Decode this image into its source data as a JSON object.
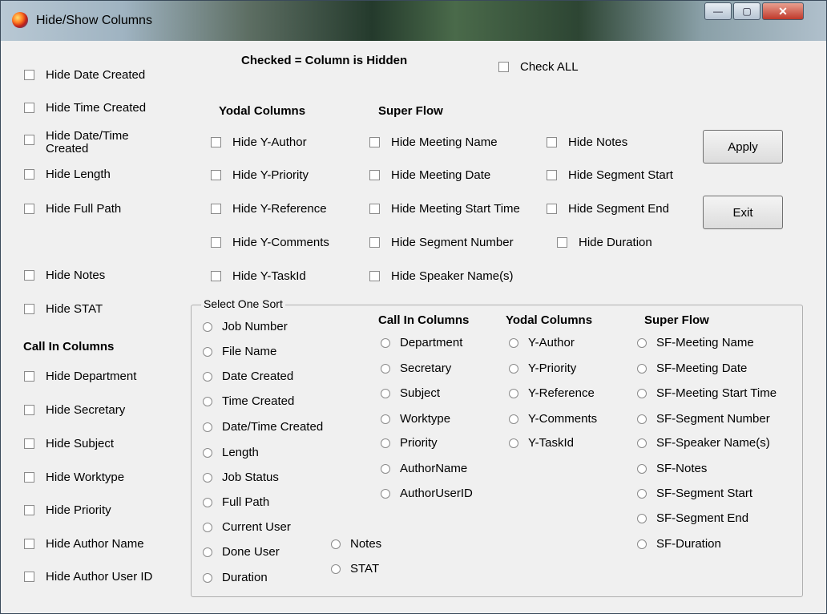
{
  "window": {
    "title": "Hide/Show Columns",
    "minimize": "—",
    "maximize": "▢",
    "close": "✕"
  },
  "header": {
    "legend": "Checked = Column is Hidden",
    "check_all": "Check ALL"
  },
  "left_checks": [
    "Hide Date Created",
    "Hide Time Created",
    "Hide Date/Time Created",
    "Hide Length",
    "Hide Full Path",
    "Hide Notes",
    "Hide STAT"
  ],
  "call_in": {
    "heading": "Call In Columns",
    "items": [
      "Hide Department",
      "Hide Secretary",
      "Hide Subject",
      "Hide Worktype",
      "Hide Priority",
      "Hide Author Name",
      "Hide Author User ID"
    ]
  },
  "yodal": {
    "heading": "Yodal Columns",
    "items": [
      "Hide Y-Author",
      "Hide Y-Priority",
      "Hide Y-Reference",
      "Hide Y-Comments",
      "Hide Y-TaskId"
    ]
  },
  "super_flow": {
    "heading": "Super Flow",
    "col1": [
      "Hide Meeting Name",
      "Hide Meeting Date",
      "Hide Meeting Start Time",
      "Hide Segment Number",
      "Hide Speaker Name(s)"
    ],
    "col2": [
      "Hide Notes",
      "Hide Segment Start",
      "Hide Segment End",
      "Hide Duration"
    ]
  },
  "buttons": {
    "apply": "Apply",
    "exit": "Exit"
  },
  "sort": {
    "label": "Select One Sort",
    "basic": [
      "Job Number",
      "File Name",
      "Date Created",
      "Time Created",
      "Date/Time Created",
      "Length",
      "Job Status",
      "Full Path",
      "Current User",
      "Done User",
      "Duration"
    ],
    "extra": [
      "Notes",
      "STAT"
    ],
    "call_in_heading": "Call In Columns",
    "call_in": [
      "Department",
      "Secretary",
      "Subject",
      "Worktype",
      "Priority",
      "AuthorName",
      "AuthorUserID"
    ],
    "yodal_heading": "Yodal Columns",
    "yodal": [
      "Y-Author",
      "Y-Priority",
      "Y-Reference",
      "Y-Comments",
      "Y-TaskId"
    ],
    "super_heading": "Super Flow",
    "super": [
      "SF-Meeting Name",
      "SF-Meeting Date",
      "SF-Meeting Start Time",
      "SF-Segment Number",
      "SF-Speaker Name(s)",
      "SF-Notes",
      "SF-Segment Start",
      "SF-Segment End",
      "SF-Duration"
    ]
  }
}
